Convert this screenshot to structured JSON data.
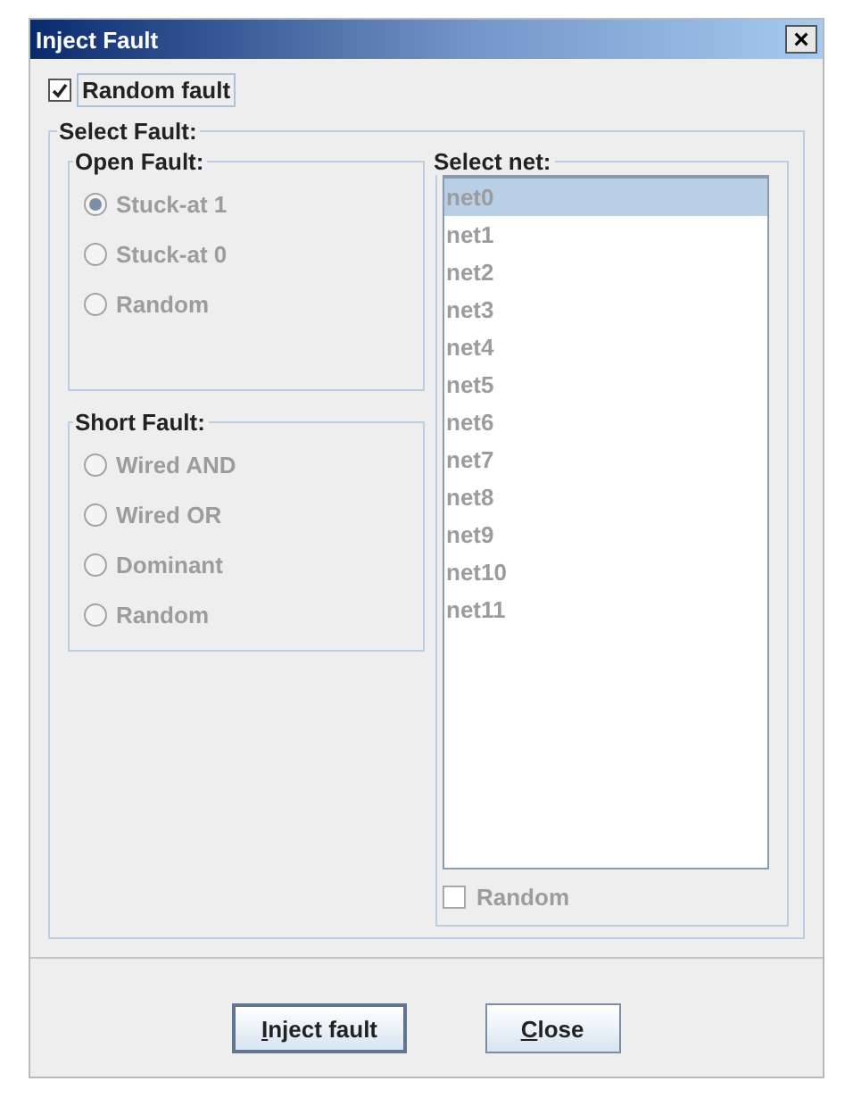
{
  "window": {
    "title": "Inject Fault",
    "close_glyph": "×"
  },
  "random_fault": {
    "label": "Random fault",
    "checked": true,
    "disabled": false
  },
  "select_fault": {
    "title": "Select Fault:",
    "open_fault": {
      "title": "Open Fault:",
      "options": [
        {
          "label": "Stuck-at 1",
          "selected": true,
          "disabled": true
        },
        {
          "label": "Stuck-at 0",
          "selected": false,
          "disabled": true
        },
        {
          "label": "Random",
          "selected": false,
          "disabled": true
        }
      ]
    },
    "short_fault": {
      "title": "Short Fault:",
      "options": [
        {
          "label": "Wired AND",
          "selected": false,
          "disabled": true
        },
        {
          "label": "Wired OR",
          "selected": false,
          "disabled": true
        },
        {
          "label": "Dominant",
          "selected": false,
          "disabled": true
        },
        {
          "label": "Random",
          "selected": false,
          "disabled": true
        }
      ]
    },
    "select_net": {
      "title": "Select net:",
      "disabled": true,
      "items": [
        {
          "label": "net0",
          "selected": true
        },
        {
          "label": "net1",
          "selected": false
        },
        {
          "label": "net2",
          "selected": false
        },
        {
          "label": "net3",
          "selected": false
        },
        {
          "label": "net4",
          "selected": false
        },
        {
          "label": "net5",
          "selected": false
        },
        {
          "label": "net6",
          "selected": false
        },
        {
          "label": "net7",
          "selected": false
        },
        {
          "label": "net8",
          "selected": false
        },
        {
          "label": "net9",
          "selected": false
        },
        {
          "label": "net10",
          "selected": false
        },
        {
          "label": "net11",
          "selected": false
        }
      ],
      "random": {
        "label": "Random",
        "checked": false,
        "disabled": true
      }
    }
  },
  "buttons": [
    {
      "mnemonic": "I",
      "label_rest": "nject fault",
      "default": true
    },
    {
      "mnemonic": "C",
      "label_rest": "lose",
      "default": false
    }
  ]
}
